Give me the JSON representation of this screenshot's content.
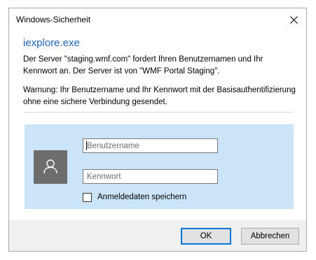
{
  "window": {
    "title": "Windows-Sicherheit"
  },
  "header": {
    "app_name": "iexplore.exe",
    "message": "Der Server \"staging.wmf.com\" fordert Ihren Benutzernamen und Ihr Kennwort an. Der Server ist von \"WMF Portal Staging\".",
    "warning": "Warnung: Ihr Benutzername und Ihr Kennwort mit der Basisauthentifizierung ohne eine sichere Verbindung gesendet."
  },
  "credentials": {
    "username_value": "",
    "username_placeholder": "Benutzername",
    "password_value": "",
    "password_placeholder": "Kennwort",
    "remember_label": "Anmeldedaten speichern",
    "remember_checked": false
  },
  "buttons": {
    "ok": "OK",
    "cancel": "Abbrechen"
  },
  "colors": {
    "accent": "#0078d7",
    "app_name": "#1c64b8",
    "panel_background": "#cce4f7",
    "avatar_background": "#6d6d6d",
    "footer_background": "#f0f0f0"
  },
  "icons": {
    "close": "close-icon",
    "avatar": "user-icon"
  }
}
